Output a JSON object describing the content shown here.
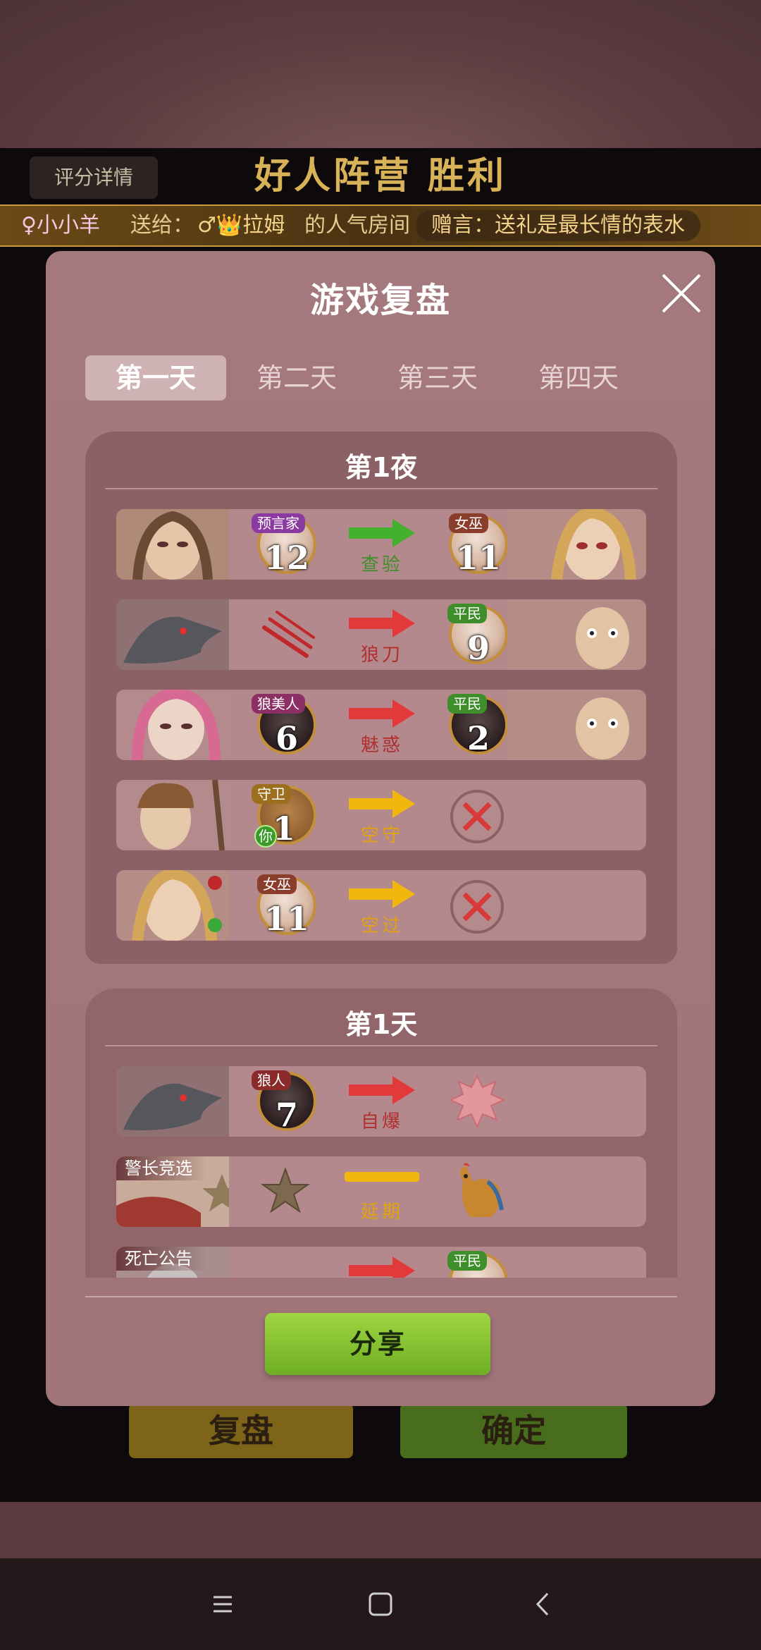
{
  "background": {
    "score_detail": "评分详情",
    "result_title": "好人阵营  胜利",
    "ticker": {
      "sender": "♀小小羊",
      "give": "送给：",
      "receiver": "♂👑拉姆",
      "suffix": "的人气房间",
      "message": "赠言：送礼是最长情的表水"
    },
    "replay_label": "复盘",
    "confirm_label": "确定"
  },
  "modal": {
    "title": "游戏复盘",
    "tabs": [
      "第一天",
      "第二天",
      "第三天",
      "第四天"
    ],
    "active_tab": "第一天",
    "sections": [
      {
        "title": "第1夜",
        "rows": [
          {
            "actor_role": "预言家",
            "actor_seat": "12",
            "action": "查验",
            "target_role": "女巫",
            "target_seat": "11",
            "arrow_color": "#44b12e"
          },
          {
            "actor_role": "",
            "actor_seat": "",
            "action": "狼刀",
            "target_role": "平民",
            "target_seat": "9",
            "arrow_color": "#e23a3a"
          },
          {
            "actor_role": "狼美人",
            "actor_seat": "6",
            "action": "魅惑",
            "target_role": "平民",
            "target_seat": "2",
            "arrow_color": "#e23a3a"
          },
          {
            "actor_role": "守卫",
            "actor_seat": "1",
            "you_badge": "你",
            "action": "空守",
            "target_role": "",
            "target_seat": "",
            "arrow_color": "#f2b70f"
          },
          {
            "actor_role": "女巫",
            "actor_seat": "11",
            "action": "空过",
            "target_role": "",
            "target_seat": "",
            "arrow_color": "#f2b70f"
          }
        ]
      },
      {
        "title": "第1天",
        "rows": [
          {
            "actor_role": "狼人",
            "actor_seat": "7",
            "action": "自爆",
            "arrow_color": "#e23a3a"
          },
          {
            "row_label": "警长竞选",
            "action": "延期",
            "arrow_color": "#f2b70f"
          },
          {
            "row_label": "死亡公告",
            "target_role": "平民",
            "arrow_color": "#e23a3a"
          }
        ]
      }
    ],
    "share_label": "分享"
  },
  "colors": {
    "modal_bg": "#a4797d",
    "section_bg": "#8b6165",
    "row_bg": "#b4898d",
    "share_green": "#8bc934",
    "gold": "#d8b257"
  }
}
